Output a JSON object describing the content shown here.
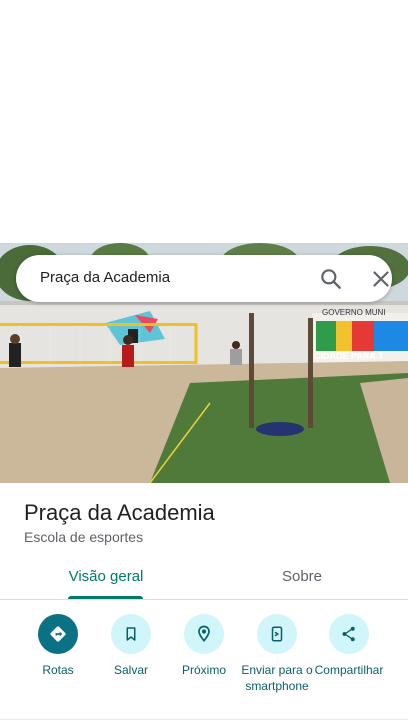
{
  "search": {
    "query": "Praça da Academia",
    "search_icon": "search-icon",
    "close_icon": "close-icon"
  },
  "photo": {
    "signage": [
      "GOVERNO MUNI",
      "CIDADE PARA T"
    ]
  },
  "place": {
    "name": "Praça da Academia",
    "category": "Escola de esportes"
  },
  "tabs": [
    {
      "label": "Visão geral",
      "active": true
    },
    {
      "label": "Sobre",
      "active": false
    }
  ],
  "actions": [
    {
      "label": "Rotas",
      "icon": "directions-icon"
    },
    {
      "label": "Salvar",
      "icon": "bookmark-icon"
    },
    {
      "label": "Próximo",
      "icon": "nearby-icon"
    },
    {
      "label": "Enviar para o smartphone",
      "icon": "send-to-phone-icon"
    },
    {
      "label": "Compartilhar",
      "icon": "share-icon"
    }
  ],
  "colors": {
    "accent": "#00796b",
    "action_primary": "#0b7285",
    "action_secondary": "#d0f5fa"
  }
}
